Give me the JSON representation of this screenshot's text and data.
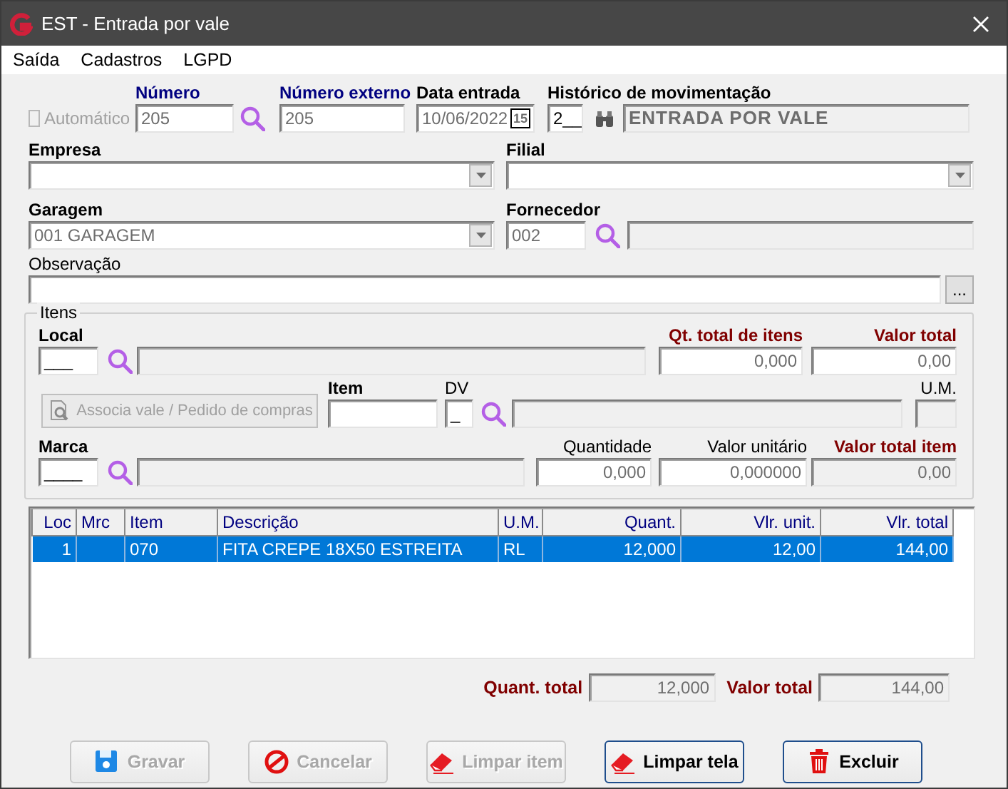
{
  "window": {
    "title": "EST - Entrada por vale"
  },
  "menu": [
    {
      "label": "Saída"
    },
    {
      "label": "Cadastros"
    },
    {
      "label": "LGPD"
    }
  ],
  "header": {
    "automatico": {
      "label": "Automático",
      "checked": false,
      "disabled": true
    },
    "numero": {
      "label": "Número",
      "value": "205"
    },
    "numero_externo": {
      "label": "Número externo",
      "value": "205"
    },
    "data_entrada": {
      "label": "Data entrada",
      "value": "10/06/2022",
      "calendar": "15"
    },
    "historico": {
      "label": "Histórico de movimentação",
      "code": "2__",
      "description": "ENTRADA POR VALE"
    },
    "empresa": {
      "label": "Empresa"
    },
    "filial": {
      "label": "Filial"
    },
    "garagem": {
      "label": "Garagem",
      "value": "001 GARAGEM"
    },
    "fornecedor": {
      "label": "Fornecedor",
      "code": "002"
    },
    "observacao": {
      "label": "Observação",
      "button": "..."
    }
  },
  "itens": {
    "title": "Itens",
    "local": {
      "label": "Local",
      "value": "___"
    },
    "qt_total": {
      "label": "Qt. total de itens",
      "value": "0,000"
    },
    "valor_total": {
      "label": "Valor total",
      "value": "0,00"
    },
    "associa_button": {
      "label": "Associa vale / Pedido de compras",
      "disabled": true
    },
    "item": {
      "label": "Item"
    },
    "dv": {
      "label": "DV",
      "value": "_"
    },
    "um": {
      "label": "U.M."
    },
    "marca": {
      "label": "Marca",
      "value": "____"
    },
    "quantidade": {
      "label": "Quantidade",
      "value": "0,000"
    },
    "valor_unitario": {
      "label": "Valor unitário",
      "value": "0,000000"
    },
    "valor_total_item": {
      "label": "Valor total item",
      "value": "0,00"
    }
  },
  "table": {
    "columns": [
      {
        "label": "Loc",
        "kind": "number"
      },
      {
        "label": "Mrc",
        "kind": "text"
      },
      {
        "label": "Item",
        "kind": "text"
      },
      {
        "label": "Descrição",
        "kind": "text"
      },
      {
        "label": "U.M.",
        "kind": "text"
      },
      {
        "label": "Quant.",
        "kind": "number"
      },
      {
        "label": "Vlr. unit.",
        "kind": "number"
      },
      {
        "label": "Vlr. total",
        "kind": "number"
      }
    ],
    "rows": [
      {
        "selected": true,
        "loc": "1",
        "item": "070",
        "descricao": "FITA CREPE 18X50 ESTREITA",
        "um": "RL",
        "quant": "12,000",
        "vlr_unit": "12,00",
        "vlr_total": "144,00"
      }
    ]
  },
  "totals": {
    "quant_total": {
      "label": "Quant. total",
      "value": "12,000"
    },
    "valor_total": {
      "label": "Valor total",
      "value": "144,00"
    }
  },
  "buttons": [
    {
      "label": "Gravar",
      "kind": "save",
      "disabled": true
    },
    {
      "label": "Cancelar",
      "kind": "cancel",
      "disabled": true
    },
    {
      "label": "Limpar item",
      "kind": "eraser",
      "disabled": true
    },
    {
      "label": "Limpar tela",
      "kind": "eraser",
      "disabled": false
    },
    {
      "label": "Excluir",
      "kind": "trash",
      "disabled": false
    }
  ]
}
